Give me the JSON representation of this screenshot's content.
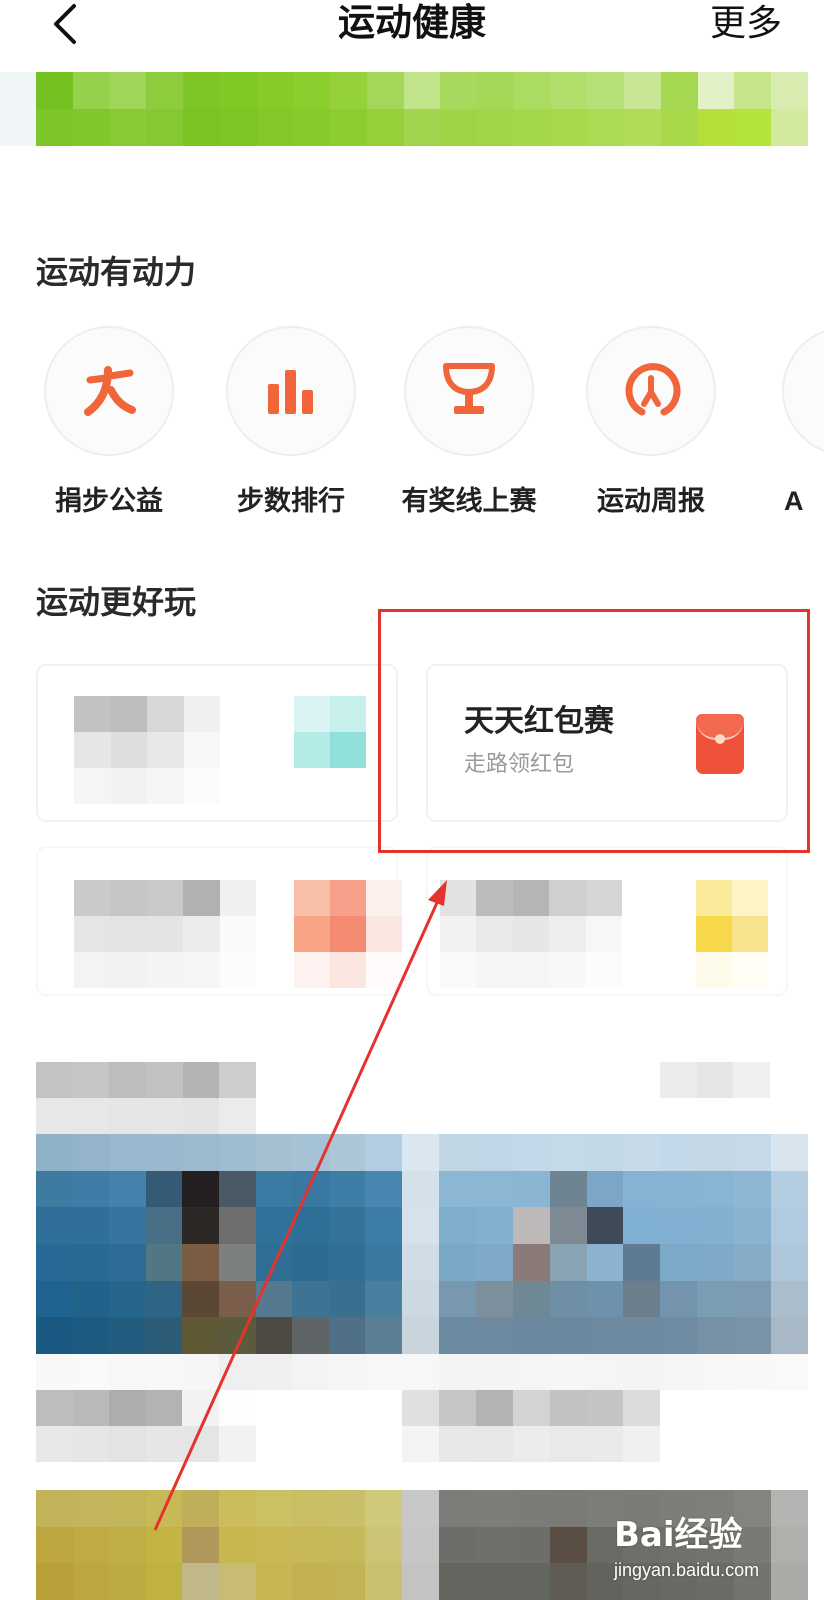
{
  "header": {
    "title": "运动健康",
    "more_label": "更多"
  },
  "sections": {
    "motivation_title": "运动有动力",
    "fun_title": "运动更好玩"
  },
  "shortcuts": [
    {
      "label": "捐步公益",
      "icon": "donate-steps-icon"
    },
    {
      "label": "步数排行",
      "icon": "bar-chart-icon"
    },
    {
      "label": "有奖线上赛",
      "icon": "trophy-icon"
    },
    {
      "label": "运动周报",
      "icon": "weekly-report-icon"
    },
    {
      "label": "A",
      "icon": "partial-icon"
    }
  ],
  "cards": {
    "red_packet": {
      "title": "天天红包赛",
      "subtitle": "走路领红包",
      "icon": "red-packet-icon"
    }
  },
  "watermark": {
    "brand": "Bai经验",
    "url": "jingyan.baidu.com"
  },
  "colors": {
    "accent_orange": "#f0663a",
    "highlight_red": "#e4332d",
    "banner_green": "#8bcd2f"
  }
}
